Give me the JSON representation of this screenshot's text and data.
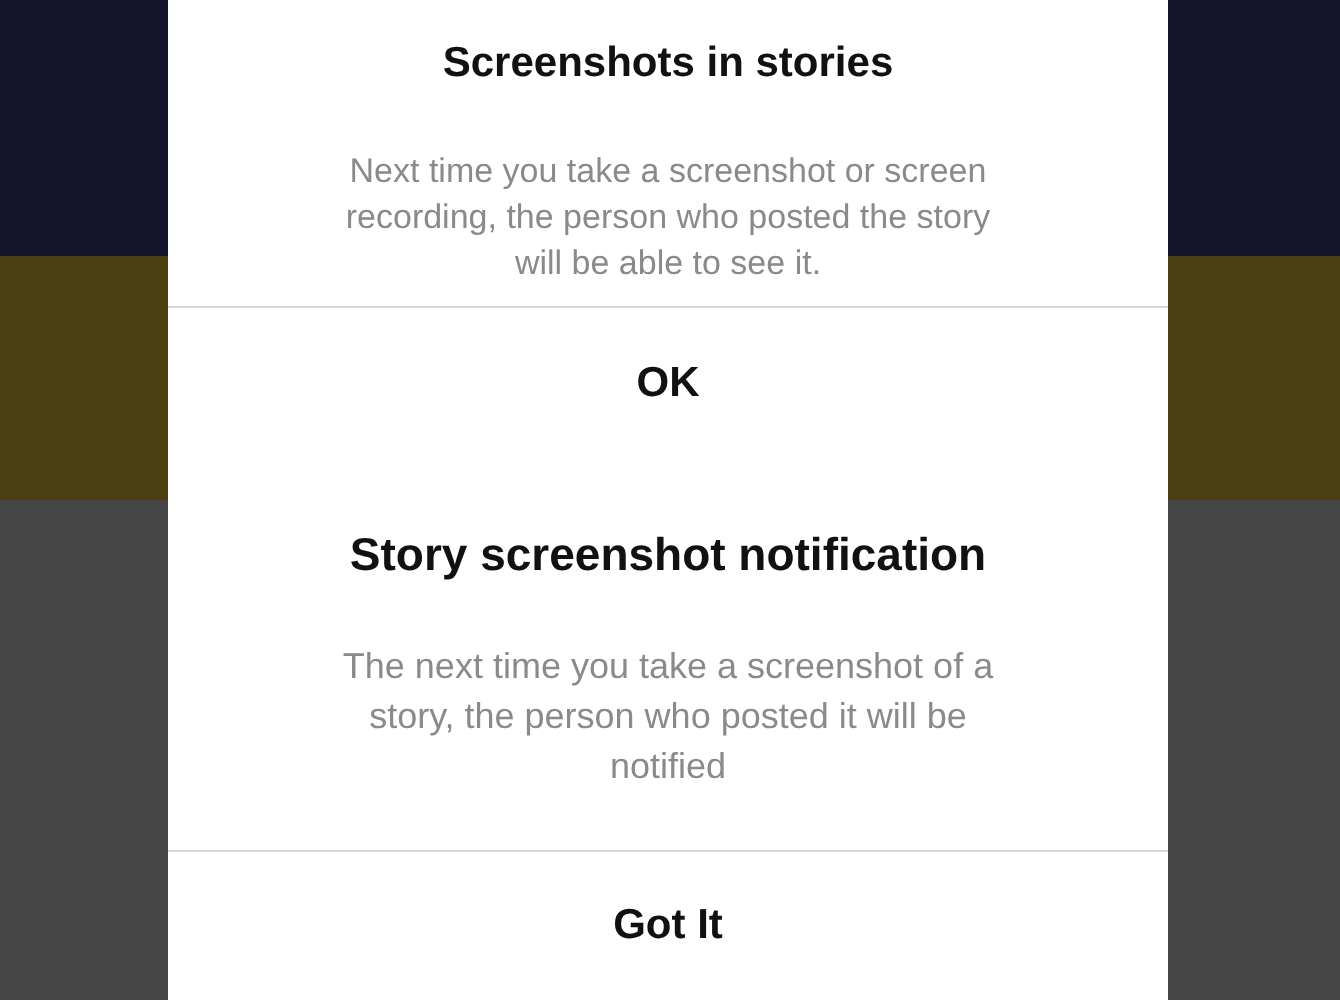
{
  "dialogs": [
    {
      "title": "Screenshots in stories",
      "message": "Next time you take a screenshot or screen recording, the person who posted the story will be able to see it.",
      "button": "OK"
    },
    {
      "title": "Story screenshot notification",
      "message": "The next time you take a screenshot of a story, the person who posted it will be notified",
      "button": "Got It"
    }
  ]
}
